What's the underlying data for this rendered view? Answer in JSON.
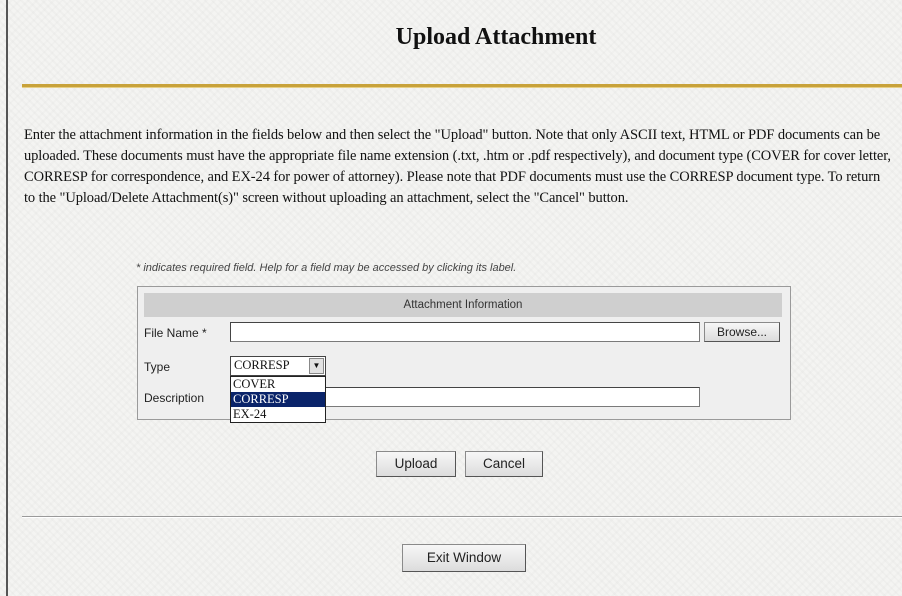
{
  "page": {
    "title": "Upload Attachment",
    "instructions": "Enter the attachment information in the fields below and then select the \"Upload\" button. Note that only ASCII text, HTML or PDF documents can be uploaded. These documents must have the appropriate file name extension (.txt, .htm or .pdf respectively), and document type (COVER for cover letter, CORRESP for correspondence, and EX-24 for power of attorney). Please note that PDF documents must use the CORRESP document type. To return to the \"Upload/Delete Attachment(s)\" screen without uploading an attachment, select the \"Cancel\" button.",
    "required_note": "* indicates required field. Help for a field may be accessed by clicking its label."
  },
  "form": {
    "header": "Attachment Information",
    "file_name_label": "File Name *",
    "file_name_value": "",
    "browse_label": "Browse...",
    "type_label": "Type",
    "type_selected": "CORRESP",
    "type_options": [
      "COVER",
      "CORRESP",
      "EX-24"
    ],
    "description_label": "Description",
    "description_value": ""
  },
  "actions": {
    "upload_label": "Upload",
    "cancel_label": "Cancel",
    "exit_label": "Exit Window"
  },
  "colors": {
    "accent_rule": "#c8a23a",
    "selected_option": "#0a246a"
  }
}
